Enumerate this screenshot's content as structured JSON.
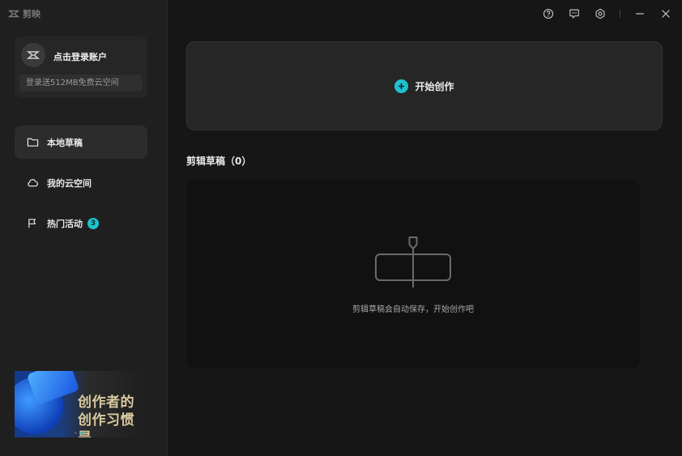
{
  "app": {
    "logo_text": "剪映"
  },
  "login": {
    "title": "点击登录账户",
    "promo": "登录送512MB免费云空间"
  },
  "nav": {
    "items": [
      {
        "label": "本地草稿",
        "icon": "folder-icon"
      },
      {
        "label": "我的云空间",
        "icon": "cloud-icon"
      },
      {
        "label": "热门活动",
        "icon": "flag-icon",
        "badge": "3"
      }
    ]
  },
  "banner": {
    "line1": "创作者的",
    "line2": "创作习惯是"
  },
  "topbar": {
    "icons": [
      "help-icon",
      "feedback-icon",
      "settings-icon",
      "minimize-icon",
      "close-icon"
    ]
  },
  "create": {
    "label": "开始创作"
  },
  "drafts": {
    "title": "剪辑草稿（0）",
    "empty_text": "剪辑草稿会自动保存，开始创作吧"
  },
  "colors": {
    "accent": "#1ec2cf",
    "sidebar_bg": "#1f1f1f",
    "main_bg": "#161616"
  }
}
